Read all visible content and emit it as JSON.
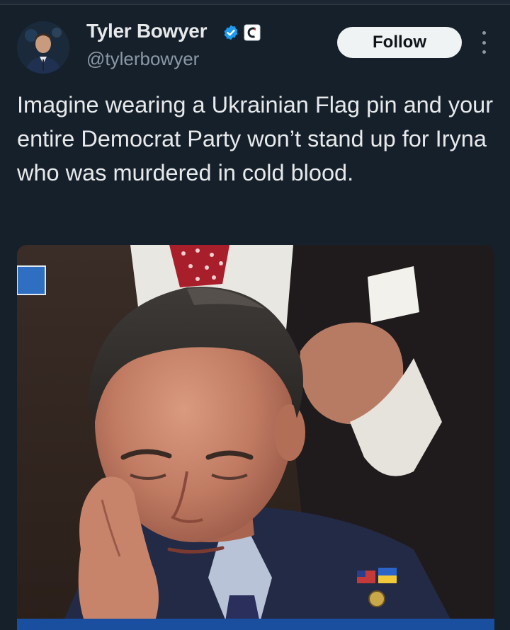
{
  "author": {
    "name": "Tyler Bowyer",
    "handle": "@tylerbowyer",
    "verified": true,
    "avatar": "avatar-photo",
    "affiliate_badge": "affiliate-badge-icon"
  },
  "actions": {
    "follow_label": "Follow",
    "more_icon": "more-options-icon"
  },
  "tweet": {
    "text": "Imagine wearing a Ukrainian Flag pin and your entire Democrat Party won’t stand up for Iryna who was murdered in cold blood."
  },
  "media": {
    "type": "photo",
    "subject": "man resting head on hand, wearing flag lapel pins"
  },
  "colors": {
    "background": "#15202b",
    "text": "#e7e9ea",
    "secondary": "#8b98a5",
    "verified_blue": "#1d9bf0",
    "follow_bg": "#eff3f4"
  }
}
